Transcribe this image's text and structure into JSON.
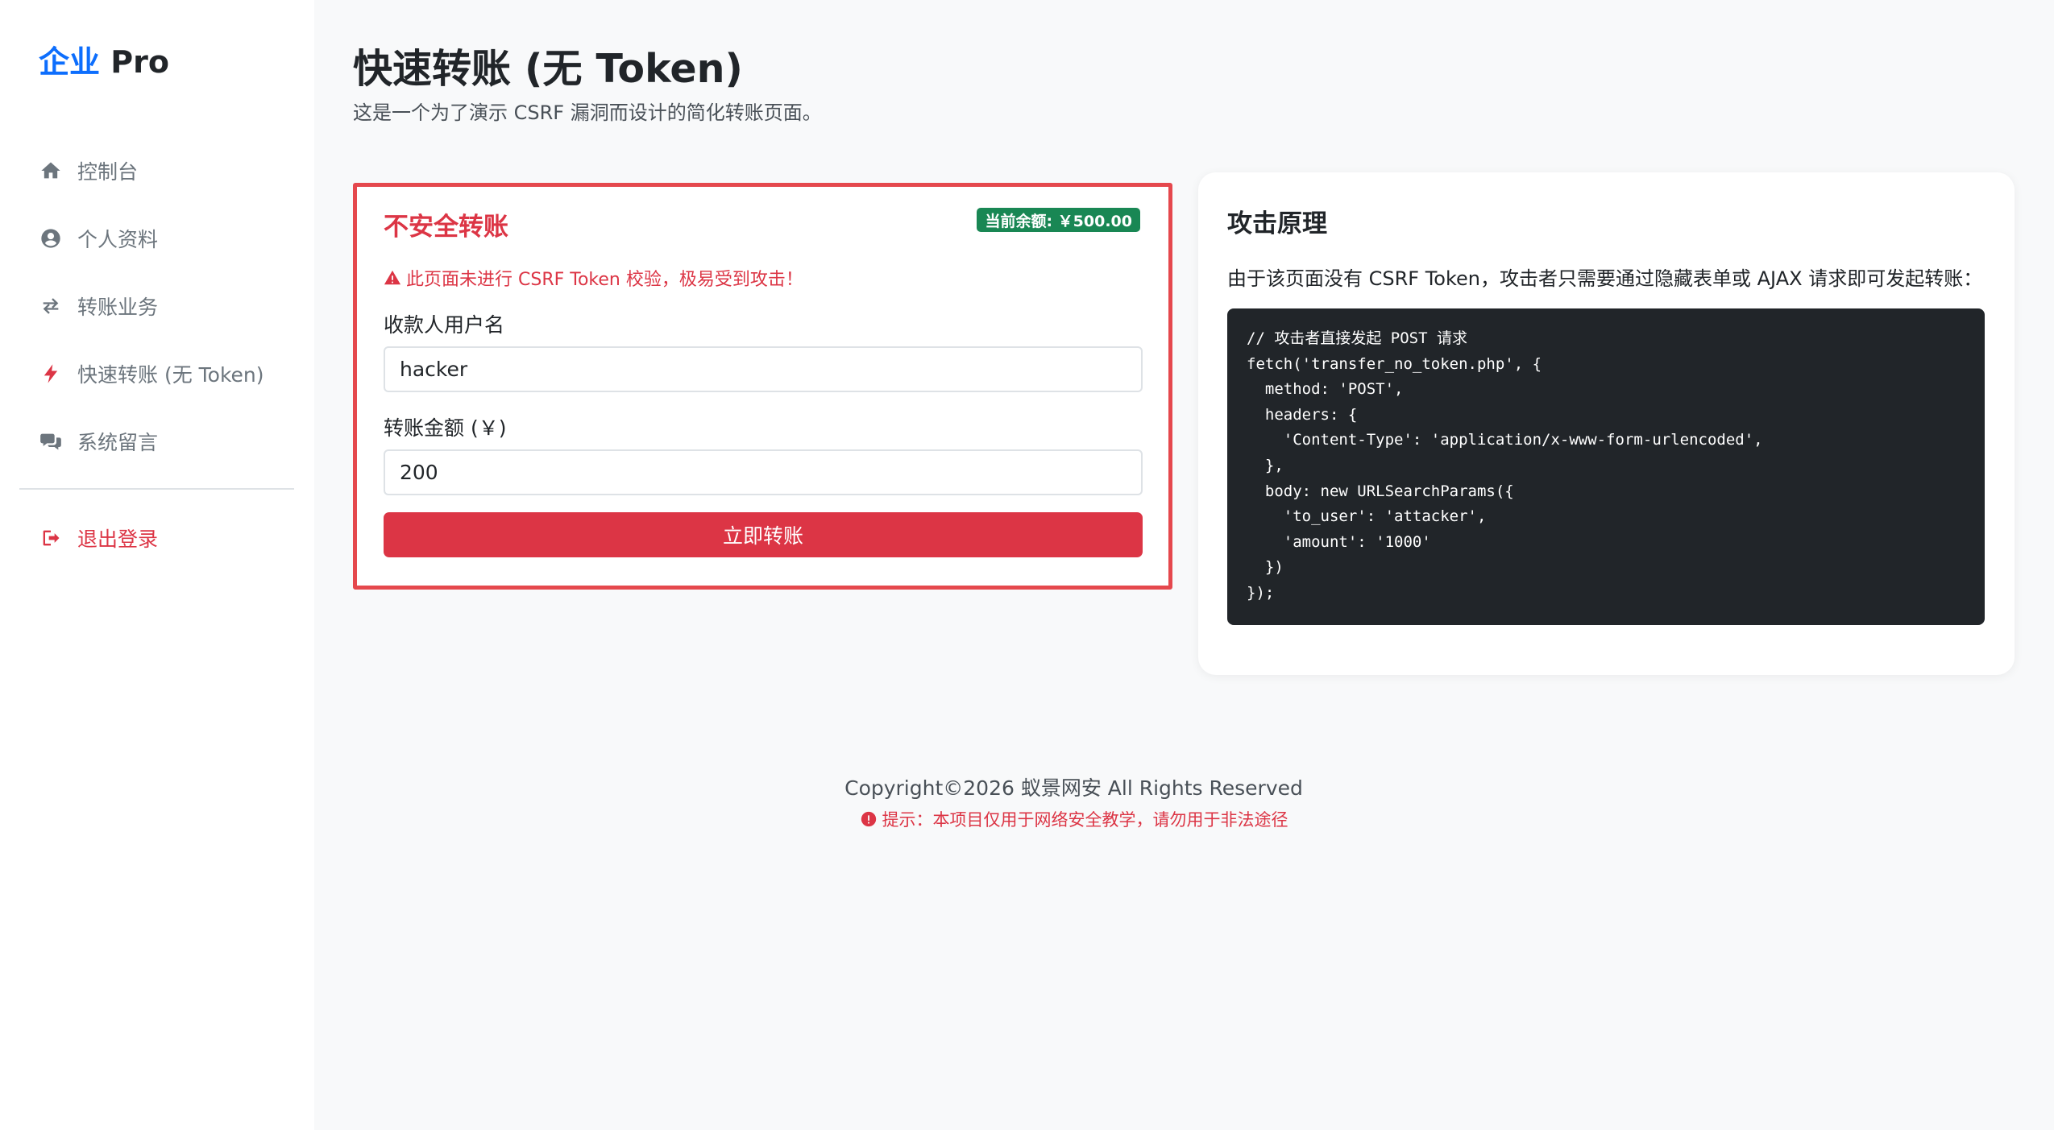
{
  "sidebar": {
    "brand_accent": "企业",
    "brand_rest": " Pro",
    "items": [
      {
        "label": "控制台",
        "icon": "home-icon"
      },
      {
        "label": "个人资料",
        "icon": "user-circle-icon"
      },
      {
        "label": "转账业务",
        "icon": "exchange-icon"
      },
      {
        "label": "快速转账 (无 Token)",
        "icon": "bolt-icon"
      },
      {
        "label": "系统留言",
        "icon": "comments-icon"
      }
    ],
    "logout_label": "退出登录",
    "logout_icon": "sign-out-icon"
  },
  "header": {
    "title": "快速转账 (无 Token)",
    "subtitle": "这是一个为了演示 CSRF 漏洞而设计的简化转账页面。"
  },
  "transfer_card": {
    "title": "不安全转账",
    "balance": "当前余额: ￥500.00",
    "warning": "此页面未进行 CSRF Token 校验，极易受到攻击！",
    "recipient_label": "收款人用户名",
    "recipient_value": "hacker",
    "amount_label": "转账金额 (￥)",
    "amount_value": "200",
    "submit_label": "立即转账"
  },
  "attack_card": {
    "title": "攻击原理",
    "description": "由于该页面没有 CSRF Token，攻击者只需要通过隐藏表单或 AJAX 请求即可发起转账：",
    "code": "// 攻击者直接发起 POST 请求\nfetch('transfer_no_token.php', {\n  method: 'POST',\n  headers: {\n    'Content-Type': 'application/x-www-form-urlencoded',\n  },\n  body: new URLSearchParams({\n    'to_user': 'attacker',\n    'amount': '1000'\n  })\n});"
  },
  "footer": {
    "copyright": "Copyright©2026 蚁景网安 All Rights Reserved",
    "note": "提示：本项目仅用于网络安全教学，请勿用于非法途径"
  },
  "colors": {
    "accent": "#0d6efd",
    "danger": "#dc3545",
    "success": "#198754",
    "code_bg": "#212529"
  }
}
